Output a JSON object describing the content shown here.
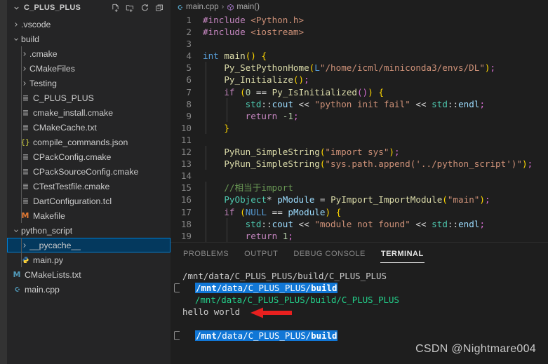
{
  "sidebar": {
    "title": "C_PLUS_PLUS",
    "chevron": "chevron-down",
    "actions": [
      {
        "name": "new-file-icon",
        "label": "New File"
      },
      {
        "name": "new-folder-icon",
        "label": "New Folder"
      },
      {
        "name": "refresh-icon",
        "label": "Refresh Explorer"
      },
      {
        "name": "collapse-all-icon",
        "label": "Collapse Folders in Explorer"
      }
    ],
    "items": [
      {
        "label": ".vscode",
        "type": "folder",
        "state": "collapsed",
        "depth": 1,
        "icon": ""
      },
      {
        "label": "build",
        "type": "folder",
        "state": "expanded",
        "depth": 1,
        "icon": ""
      },
      {
        "label": ".cmake",
        "type": "folder",
        "state": "collapsed",
        "depth": 2,
        "icon": ""
      },
      {
        "label": "CMakeFiles",
        "type": "folder",
        "state": "collapsed",
        "depth": 2,
        "icon": ""
      },
      {
        "label": "Testing",
        "type": "folder",
        "state": "collapsed",
        "depth": 2,
        "icon": ""
      },
      {
        "label": "C_PLUS_PLUS",
        "type": "file",
        "depth": 2,
        "icon": "binary-file-icon",
        "glyph": "≡",
        "color": "#c5c5c5"
      },
      {
        "label": "cmake_install.cmake",
        "type": "file",
        "depth": 2,
        "icon": "cmake-file-icon",
        "glyph": "≡",
        "color": "#c5c5c5"
      },
      {
        "label": "CMakeCache.txt",
        "type": "file",
        "depth": 2,
        "icon": "text-file-icon",
        "glyph": "≡",
        "color": "#c5c5c5"
      },
      {
        "label": "compile_commands.json",
        "type": "file",
        "depth": 2,
        "icon": "json-file-icon",
        "glyph": "{}",
        "color": "#cbcb41"
      },
      {
        "label": "CPackConfig.cmake",
        "type": "file",
        "depth": 2,
        "icon": "cmake-file-icon",
        "glyph": "≡",
        "color": "#c5c5c5"
      },
      {
        "label": "CPackSourceConfig.cmake",
        "type": "file",
        "depth": 2,
        "icon": "cmake-file-icon",
        "glyph": "≡",
        "color": "#c5c5c5"
      },
      {
        "label": "CTestTestfile.cmake",
        "type": "file",
        "depth": 2,
        "icon": "cmake-file-icon",
        "glyph": "≡",
        "color": "#c5c5c5"
      },
      {
        "label": "DartConfiguration.tcl",
        "type": "file",
        "depth": 2,
        "icon": "tcl-file-icon",
        "glyph": "≡",
        "color": "#c5c5c5"
      },
      {
        "label": "Makefile",
        "type": "file",
        "depth": 2,
        "icon": "makefile-icon",
        "glyph": "M",
        "color": "#e37933"
      },
      {
        "label": "python_script",
        "type": "folder",
        "state": "expanded",
        "depth": 1,
        "icon": ""
      },
      {
        "label": "__pycache__",
        "type": "folder",
        "state": "collapsed",
        "depth": 2,
        "icon": "",
        "selected": true
      },
      {
        "label": "main.py",
        "type": "file",
        "depth": 2,
        "icon": "python-file-icon",
        "glyph": "◐",
        "color": "#3572A5"
      },
      {
        "label": "CMakeLists.txt",
        "type": "file",
        "depth": 1,
        "icon": "makefile-icon",
        "glyph": "M",
        "color": "#519aba"
      },
      {
        "label": "main.cpp",
        "type": "file",
        "depth": 1,
        "icon": "cpp-file-icon",
        "glyph": "C",
        "color": "#519aba"
      }
    ]
  },
  "breadcrumb": {
    "file_icon": "cpp-file-icon",
    "file": "main.cpp",
    "separator": "›",
    "symbol_icon": "method-symbol-icon",
    "symbol": "main()"
  },
  "editor": {
    "line_numbers": [
      "1",
      "2",
      "3",
      "4",
      "5",
      "6",
      "7",
      "8",
      "9",
      "10",
      "11",
      "12",
      "13",
      "14",
      "15",
      "16",
      "17",
      "18",
      "19"
    ],
    "lines": [
      "#include <Python.h>",
      "#include <iostream>",
      "",
      "int main() {",
      "    Py_SetPythonHome(L\"/home/icml/miniconda3/envs/DL\");",
      "    Py_Initialize();",
      "    if (0 == Py_IsInitialized()) {",
      "        std::cout << \"python init fail\" << std::endl;",
      "        return -1;",
      "    }",
      "",
      "    PyRun_SimpleString(\"import sys\");",
      "    PyRun_SimpleString(\"sys.path.append('../python_script')\");",
      "",
      "    //相当于import",
      "    PyObject* pModule = PyImport_ImportModule(\"main\");",
      "    if (NULL == pModule) {",
      "        std::cout << \"module not found\" << std::endl;",
      "        return 1;"
    ]
  },
  "panel": {
    "tabs": [
      {
        "label": "PROBLEMS",
        "active": false
      },
      {
        "label": "OUTPUT",
        "active": false
      },
      {
        "label": "DEBUG CONSOLE",
        "active": false
      },
      {
        "label": "TERMINAL",
        "active": true
      }
    ],
    "terminal": {
      "lines": [
        {
          "kind": "plain",
          "text": "/mnt/data/C_PLUS_PLUS/build/C_PLUS_PLUS"
        },
        {
          "kind": "prompt",
          "prefix": "/mnt",
          "mid": "/data/C_PLUS_PLUS/",
          "suffix": "build"
        },
        {
          "kind": "green",
          "text": "/mnt/data/C_PLUS_PLUS/build/C_PLUS_PLUS"
        },
        {
          "kind": "plain",
          "text": "hello world"
        },
        {
          "kind": "blank",
          "text": ""
        },
        {
          "kind": "prompt",
          "prefix": "/mnt",
          "mid": "/data/C_PLUS_PLUS/",
          "suffix": "build"
        }
      ]
    }
  },
  "annotation": {
    "arrow_color": "#e8201f",
    "arrow_name": "red-arrow-annotation"
  },
  "watermark": "CSDN @Nightmare004",
  "colors": {
    "accent": "#007fd4",
    "selection_bg": "#04395e",
    "terminal_highlight": "#1177d6",
    "terminal_green": "#23d18b",
    "editor_bg": "#1e1e1e",
    "sidebar_bg": "#252526"
  }
}
